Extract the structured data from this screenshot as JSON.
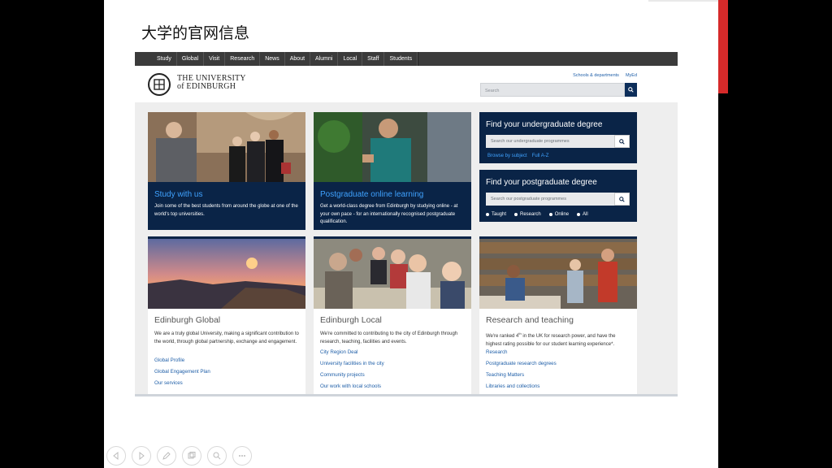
{
  "slide": {
    "title": "大学的官网信息"
  },
  "site": {
    "nav": [
      "Study",
      "Global",
      "Visit",
      "Research",
      "News",
      "About",
      "Alumni",
      "Local",
      "Staff",
      "Students"
    ],
    "logo": {
      "line1": "THE UNIVERSITY",
      "line2": "of EDINBURGH"
    },
    "top_links": [
      "Schools & departments",
      "MyEd"
    ],
    "search": {
      "placeholder": "Search"
    },
    "cards_top": [
      {
        "title": "Study with us",
        "text": "Join some of the best students from around the globe at one of the world's top universities."
      },
      {
        "title": "Postgraduate online learning",
        "text": "Get a world-class degree from Edinburgh by studying online - at your own pace - for an internationally recognised postgraduate qualification."
      }
    ],
    "finder_ug": {
      "title": "Find your undergraduate degree",
      "placeholder": "Search our undergraduate programmes",
      "links": [
        "Browse by subject",
        "Full A-Z"
      ]
    },
    "finder_pg": {
      "title": "Find your postgraduate degree",
      "placeholder": "Search our postgraduate programmes",
      "options": [
        "Taught",
        "Research",
        "Online",
        "All"
      ]
    },
    "cards_bottom": [
      {
        "title": "Edinburgh Global",
        "text": "We are a truly global University, making a significant contribution to the world, through global partnership, exchange and engagement.",
        "links": [
          "Global Profile",
          "Global Engagement Plan",
          "Our services"
        ]
      },
      {
        "title": "Edinburgh Local",
        "text": "We're committed to contributing to the city of Edinburgh through research, teaching, facilities and events.",
        "links": [
          "City Region Deal",
          "University facilities in the city",
          "Community projects",
          "Our work with local schools"
        ]
      },
      {
        "title": "Research and teaching",
        "text_before": "We're ranked 4",
        "text_sup": "th",
        "text_after": " in the UK for research power, and have the highest rating possible for our student learning experience*.",
        "links": [
          "Research",
          "Postgraduate research degrees",
          "Teaching Matters",
          "Libraries and collections"
        ]
      }
    ]
  },
  "toolbar": {
    "icons": [
      "previous-icon",
      "play-icon",
      "pen-icon",
      "slides-icon",
      "zoom-icon",
      "more-icon"
    ]
  }
}
